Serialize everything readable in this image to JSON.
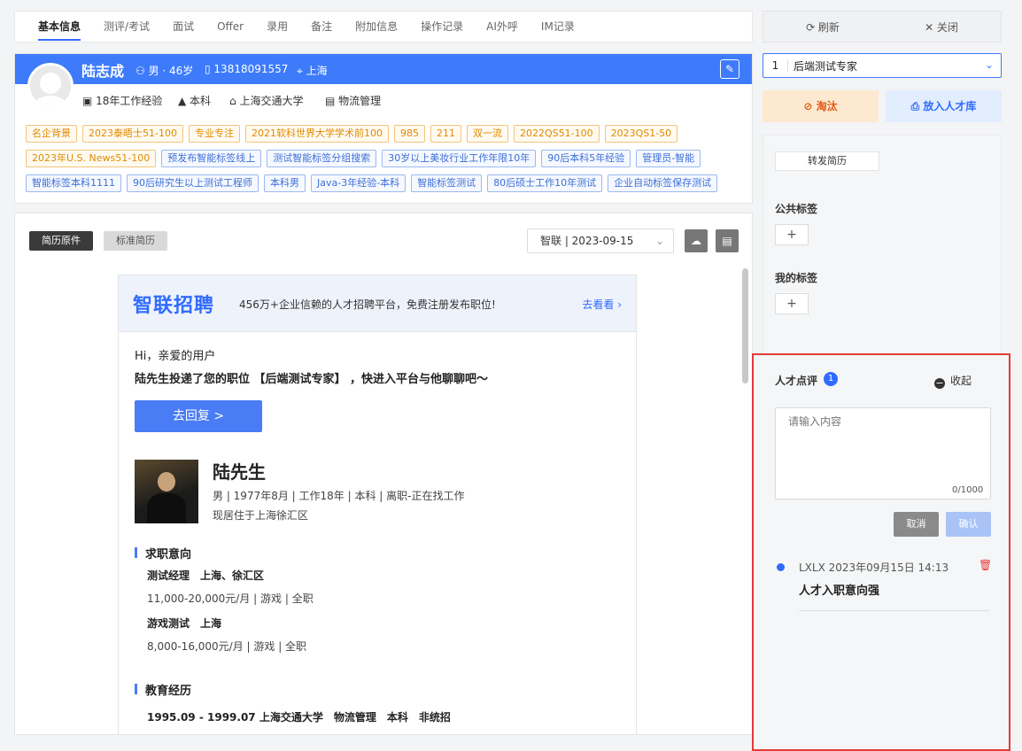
{
  "tabs": [
    "基本信息",
    "测评/考试",
    "面试",
    "Offer",
    "录用",
    "备注",
    "附加信息",
    "操作记录",
    "AI外呼",
    "IM记录"
  ],
  "top_actions": {
    "refresh": "⟳ 刷新",
    "close": "✕ 关闭"
  },
  "candidate": {
    "name": "陆志成",
    "gender_age": "男 · 46岁",
    "phone": "13818091557",
    "city": "上海",
    "experience": "18年工作经验",
    "degree": "本科",
    "school": "上海交通大学",
    "major": "物流管理"
  },
  "tags_row1": [
    "名企背景",
    "2023泰晤士51-100",
    "专业专注",
    "2021软科世界大学学术前100",
    "985",
    "211",
    "双一流",
    "2022QS51-100",
    "2023QS1-50"
  ],
  "tags_row2": [
    "2023年U.S. News51-100",
    "预发布智能标签线上",
    "测试智能标签分组搜索",
    "30岁以上美妆行业工作年限10年",
    "90后本科5年经验",
    "管理员-智能"
  ],
  "tags_row3": [
    "智能标签本科1111",
    "90后研究生以上测试工程师",
    "本科男",
    "Java-3年经验-本科",
    "智能标签测试",
    "80后硕士工作10年测试",
    "企业自动标签保存测试"
  ],
  "resume": {
    "original_btn": "简历原件",
    "standard_btn": "标准简历",
    "source": "智联 | 2023-09-15",
    "banner_brand": "智联招聘",
    "banner_slogan": "456万+企业信赖的人才招聘平台，免费注册发布职位!",
    "banner_link": "去看看 ›",
    "greeting": "Hi，亲爱的用户",
    "delivered": "陆先生投递了您的职位 【后端测试专家】 ，快进入平台与他聊聊吧～",
    "reply_btn": "去回复 >",
    "person_name": "陆先生",
    "person_info": "男 | 1977年8月 | 工作18年 | 本科 | 离职-正在找工作",
    "residence": "现居住于上海徐汇区",
    "intent_title": "求职意向",
    "job1_title": "测试经理　上海、徐汇区",
    "job1_detail": "11,000-20,000元/月 | 游戏 | 全职",
    "job2_title": "游戏测试　上海",
    "job2_detail": "8,000-16,000元/月 | 游戏 | 全职",
    "edu_title": "教育经历",
    "edu1": "1995.09 - 1999.07 上海交通大学　物流管理　本科　非统招"
  },
  "right": {
    "job_index": "1",
    "job_name": "后端测试专家",
    "eliminate": "淘汰",
    "add_pool": "放入人才库",
    "forward": "转发简历",
    "public_tags": "公共标签",
    "my_tags": "我的标签",
    "plus": "+"
  },
  "comment": {
    "title": "人才点评",
    "count": "1",
    "collapse": "收起",
    "collapse_icon": "−",
    "placeholder": "请输入内容",
    "counter": "0/1000",
    "cancel": "取消",
    "confirm": "确认",
    "user_time": "LXLX  2023年09月15日 14:13",
    "text": "人才入职意向强"
  },
  "colors": {
    "primary": "#2f6bff",
    "header": "#3d7bfb",
    "danger": "#e53a3a",
    "tag_orange": "#e08a00"
  }
}
